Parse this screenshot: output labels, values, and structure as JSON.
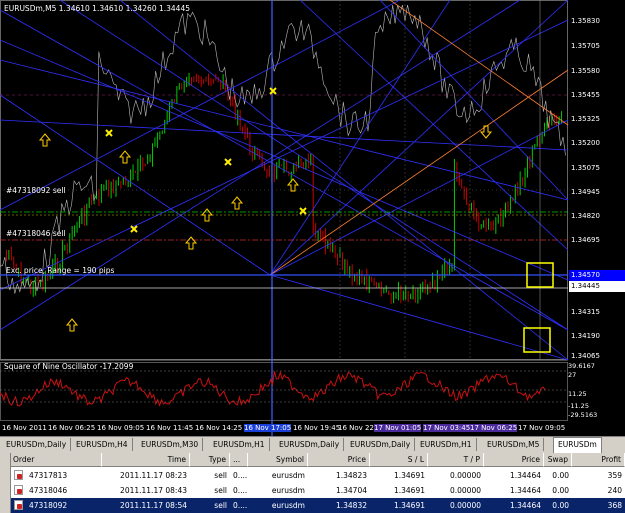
{
  "chart": {
    "header": "EURUSDm,M5  1.34610 1.34610 1.34260 1.34445",
    "labels": {
      "order1": "#47318092 sell",
      "order2": "#47318046 sell",
      "range": "Exc. price, Range = 190 pips"
    },
    "price_ticks": [
      "1.35830",
      "1.35705",
      "1.35580",
      "1.35455",
      "1.35325",
      "1.35200",
      "1.35075",
      "1.34945",
      "1.34820",
      "1.34695",
      "1.34570",
      "1.34445",
      "1.34315",
      "1.34190",
      "1.34065"
    ],
    "current_price": "1.34570",
    "last_price": "1.34445",
    "time_ticks": [
      "16 Nov 2011",
      "16 Nov 06:25",
      "16 Nov 09:05",
      "16 Nov 11:45",
      "16 Nov 14:25",
      "16 Nov 17:05",
      "16 Nov 19:45",
      "16 Nov 22:2",
      "17 Nov 01:05",
      "17 Nov 03:45",
      "17 Nov 06:25",
      "17 Nov 09:05"
    ],
    "oscillator": {
      "title": "Square of Nine Oscillator -17.2099",
      "values": [
        "39.6167",
        "27",
        "11.25",
        "-11.25",
        "-29.5163"
      ]
    },
    "colors": {
      "background": "#000000",
      "bull": "#00cc00",
      "bear": "#cc0000",
      "fan": "#3030ff",
      "accent": "#ff8030"
    }
  },
  "tabs": [
    "EURUSDm,Daily",
    "EURUSDm,H4",
    "EURUSDm,M30",
    "EURUSDm,H1",
    "EURUSDm,Daily",
    "EURUSDm,Daily",
    "EURUSDm,H1",
    "EURUSDm,M5",
    "EURUSDm"
  ],
  "orders": {
    "columns": [
      "Order",
      "Time",
      "Type",
      "...",
      "Symbol",
      "Price",
      "S / L",
      "T / P",
      "Price",
      "Swap",
      "Profit"
    ],
    "rows": [
      {
        "order": "47317813",
        "time": "2011.11.17 08:23",
        "type": "sell",
        "size": "0....",
        "symbol": "eurusdm",
        "price": "1.34823",
        "sl": "1.34691",
        "tp": "0.00000",
        "cur": "1.34464",
        "swap": "0.00",
        "profit": "359"
      },
      {
        "order": "47318046",
        "time": "2011.11.17 08:43",
        "type": "sell",
        "size": "0....",
        "symbol": "eurusdm",
        "price": "1.34704",
        "sl": "1.34691",
        "tp": "0.00000",
        "cur": "1.34464",
        "swap": "0.00",
        "profit": "240"
      },
      {
        "order": "47318092",
        "time": "2011.11.17 08:54",
        "type": "sell",
        "size": "0....",
        "symbol": "eurusdm",
        "price": "1.34832",
        "sl": "1.34691",
        "tp": "0.00000",
        "cur": "1.34464",
        "swap": "0.00",
        "profit": "368"
      }
    ]
  }
}
